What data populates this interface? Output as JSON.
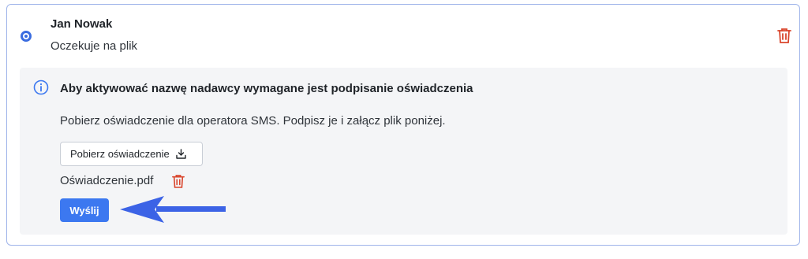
{
  "recipient": {
    "name": "Jan Nowak",
    "status": "Oczekuje na plik"
  },
  "panel": {
    "title": "Aby aktywować nazwę nadawcy wymagane jest podpisanie oświadczenia",
    "description": "Pobierz oświadczenie dla operatora SMS. Podpisz je i załącz plik poniżej.",
    "download_label": "Pobierz oświadczenie",
    "file_name": "Oświadczenie.pdf",
    "send_label": "Wyślij"
  },
  "icons": {
    "radio": "radio-selected-icon",
    "info": "info-icon",
    "download": "download-icon",
    "trash": "trash-icon",
    "arrow": "arrow-left-icon"
  },
  "colors": {
    "accent": "#3c78f0",
    "danger": "#d9452c",
    "border": "#9fb4ea",
    "panel_bg": "#f4f5f7"
  }
}
